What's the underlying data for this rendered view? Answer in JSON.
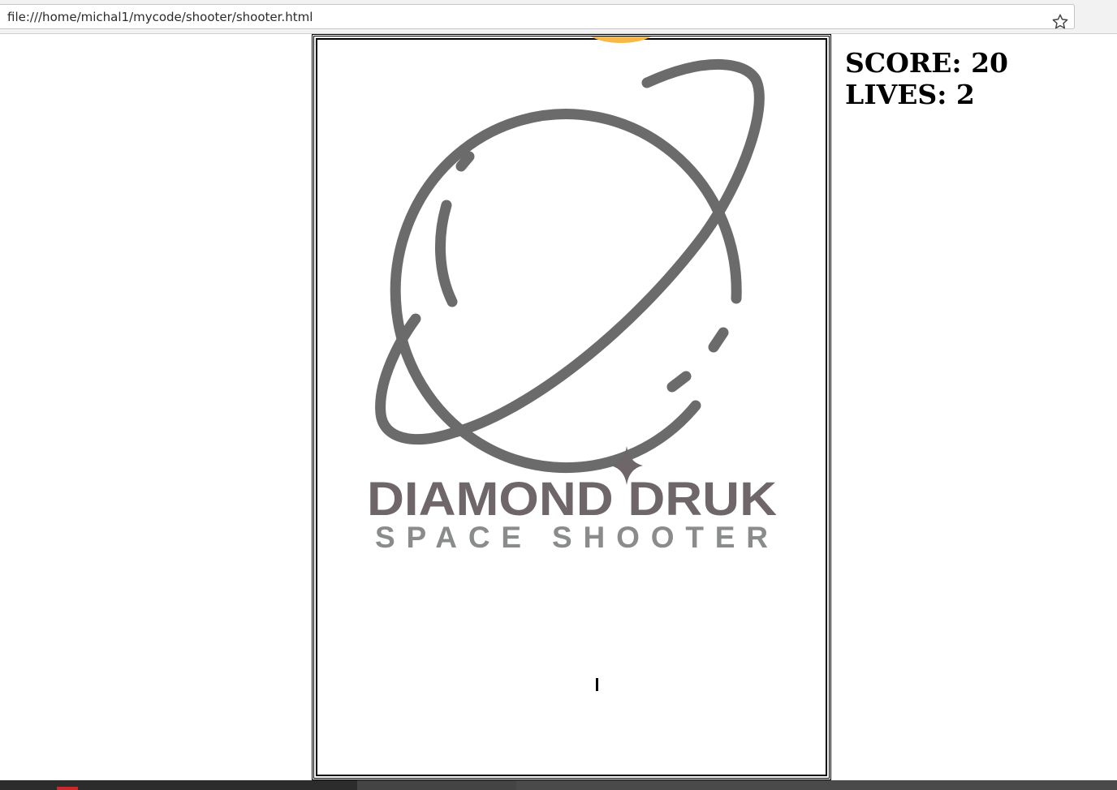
{
  "browser": {
    "url": "file:///home/michal1/mycode/shooter/shooter.html",
    "bookmark_icon": "star-outline-icon"
  },
  "game": {
    "logo": {
      "brand": "DIAMOND DRUK",
      "tagline": "SPACE SHOOTER",
      "brand_color": "#6e6668",
      "tagline_color": "#8a8c8c",
      "planet_color": "#6b6b6b"
    },
    "enemy_color": "#f7b847",
    "player_color": "#000000"
  },
  "hud": {
    "score_label": "SCORE: 20",
    "lives_label": "LIVES: 2"
  }
}
